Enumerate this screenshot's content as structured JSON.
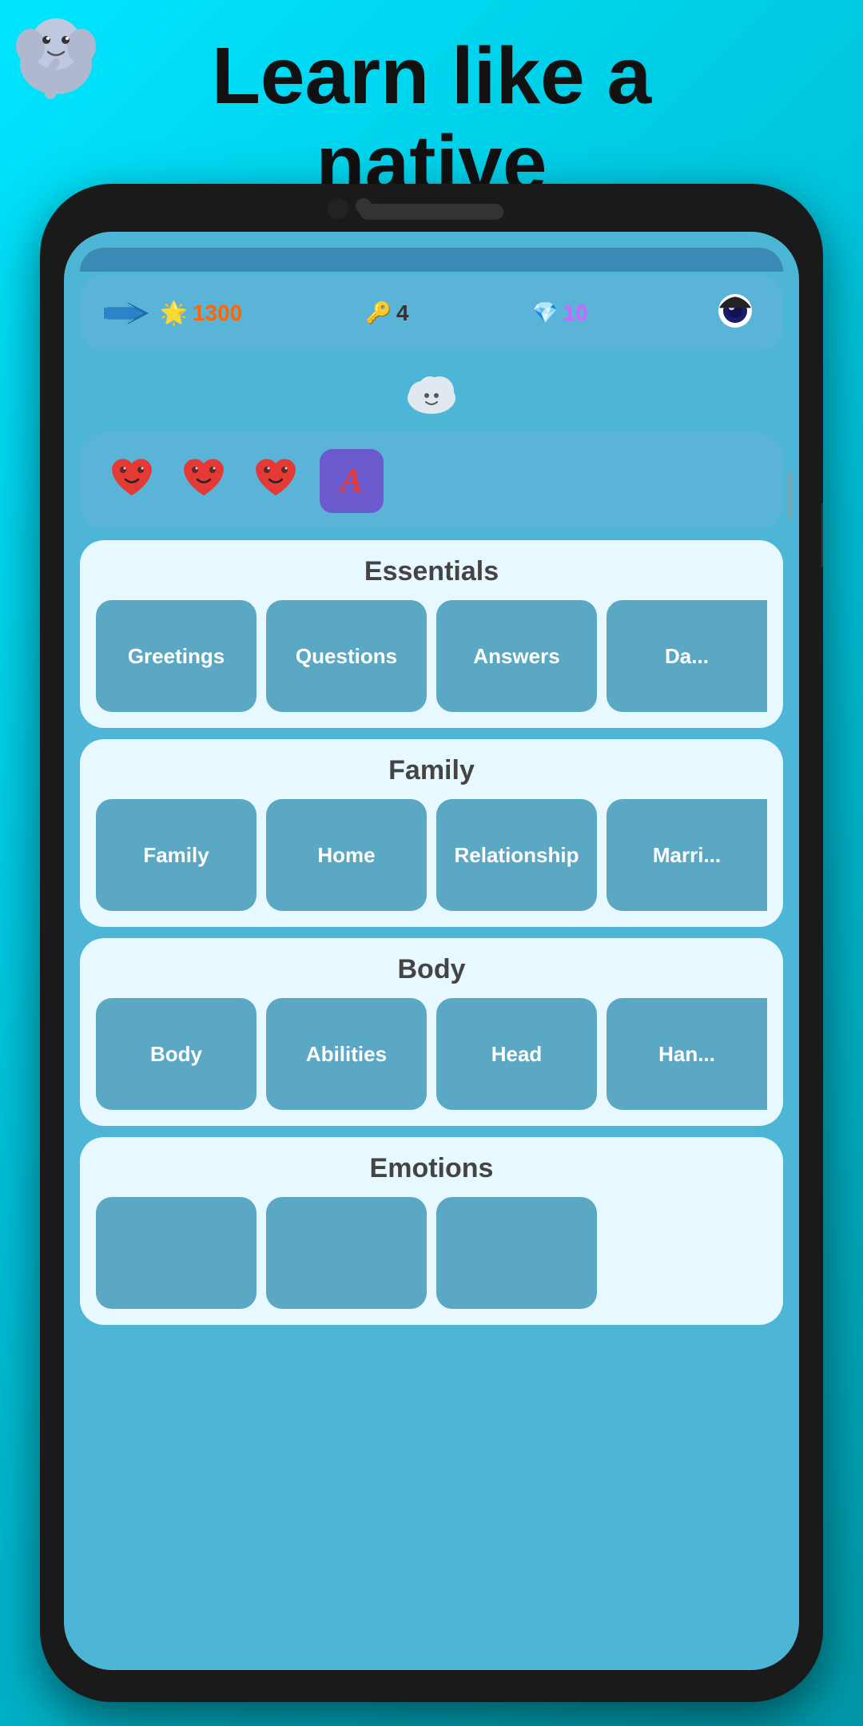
{
  "header": {
    "title_line1": "Learn like a",
    "title_line2": "native"
  },
  "stats": {
    "xp": "1300",
    "keys": "4",
    "gems": "10"
  },
  "hearts": {
    "count": 3,
    "heart_char": "❤"
  },
  "sections": [
    {
      "id": "essentials",
      "title": "Essentials",
      "items": [
        "Greetings",
        "Questions",
        "Answers",
        "Da..."
      ]
    },
    {
      "id": "family",
      "title": "Family",
      "items": [
        "Family",
        "Home",
        "Relationship",
        "Marri..."
      ]
    },
    {
      "id": "body",
      "title": "Body",
      "items": [
        "Body",
        "Abilities",
        "Head",
        "Han..."
      ]
    },
    {
      "id": "emotions",
      "title": "Emotions",
      "items": [
        "",
        "",
        ""
      ]
    }
  ],
  "colors": {
    "bg_gradient_start": "#00e5ff",
    "bg_gradient_end": "#0097a7",
    "phone_bg": "#1a1a1a",
    "screen_bg": "#4db6d6",
    "card_bg": "#5ab4d8",
    "category_bg": "#5ba8c4",
    "section_bg": "#e8f8ff",
    "accent_xp": "#ff6600",
    "accent_gems": "#cc66ff",
    "letter_badge_bg": "#6a5acd",
    "letter_badge_color": "#ff4444"
  }
}
